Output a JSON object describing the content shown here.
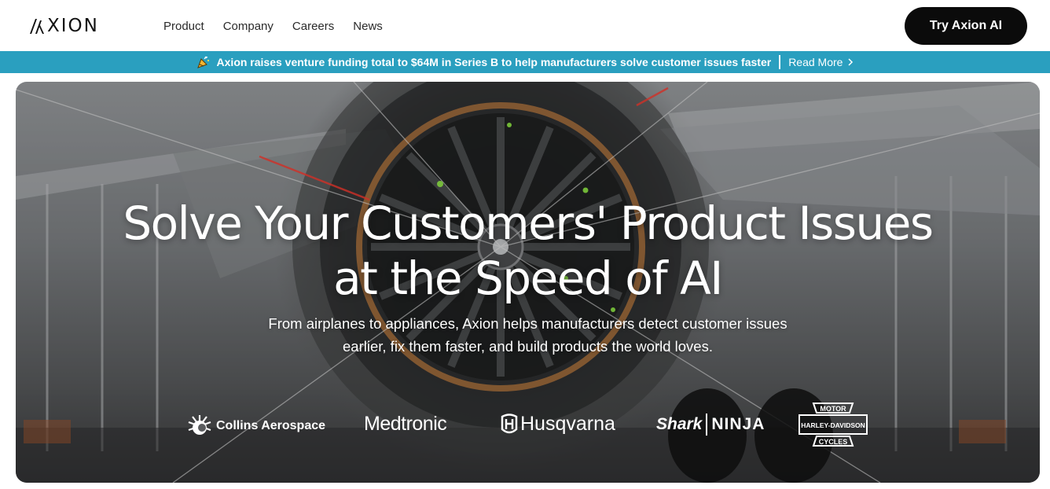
{
  "header": {
    "logo_text": "XION",
    "nav": [
      {
        "label": "Product"
      },
      {
        "label": "Company"
      },
      {
        "label": "Careers"
      },
      {
        "label": "News"
      }
    ],
    "cta_label": "Try Axion AI"
  },
  "banner": {
    "icon": "party-popper-icon",
    "text": "Axion raises venture funding total to $64M in Series B to help manufacturers solve customer issues faster",
    "link_label": "Read More",
    "background": "#2a9fbf"
  },
  "hero": {
    "title_line1": "Solve Your Customers' Product Issues",
    "title_line2": "at the Speed of AI",
    "subtitle_line1": "From airplanes to appliances, Axion helps manufacturers detect customer issues",
    "subtitle_line2": "earlier, fix them faster, and build products the world loves.",
    "logos": [
      {
        "name": "Collins Aerospace"
      },
      {
        "name": "Medtronic"
      },
      {
        "name": "Husqvarna"
      },
      {
        "name_part1": "Shark",
        "name_part2": "NINJA"
      },
      {
        "name": "HARLEY-DAVIDSON",
        "top": "MOTOR",
        "bottom": "CYCLES"
      }
    ]
  }
}
